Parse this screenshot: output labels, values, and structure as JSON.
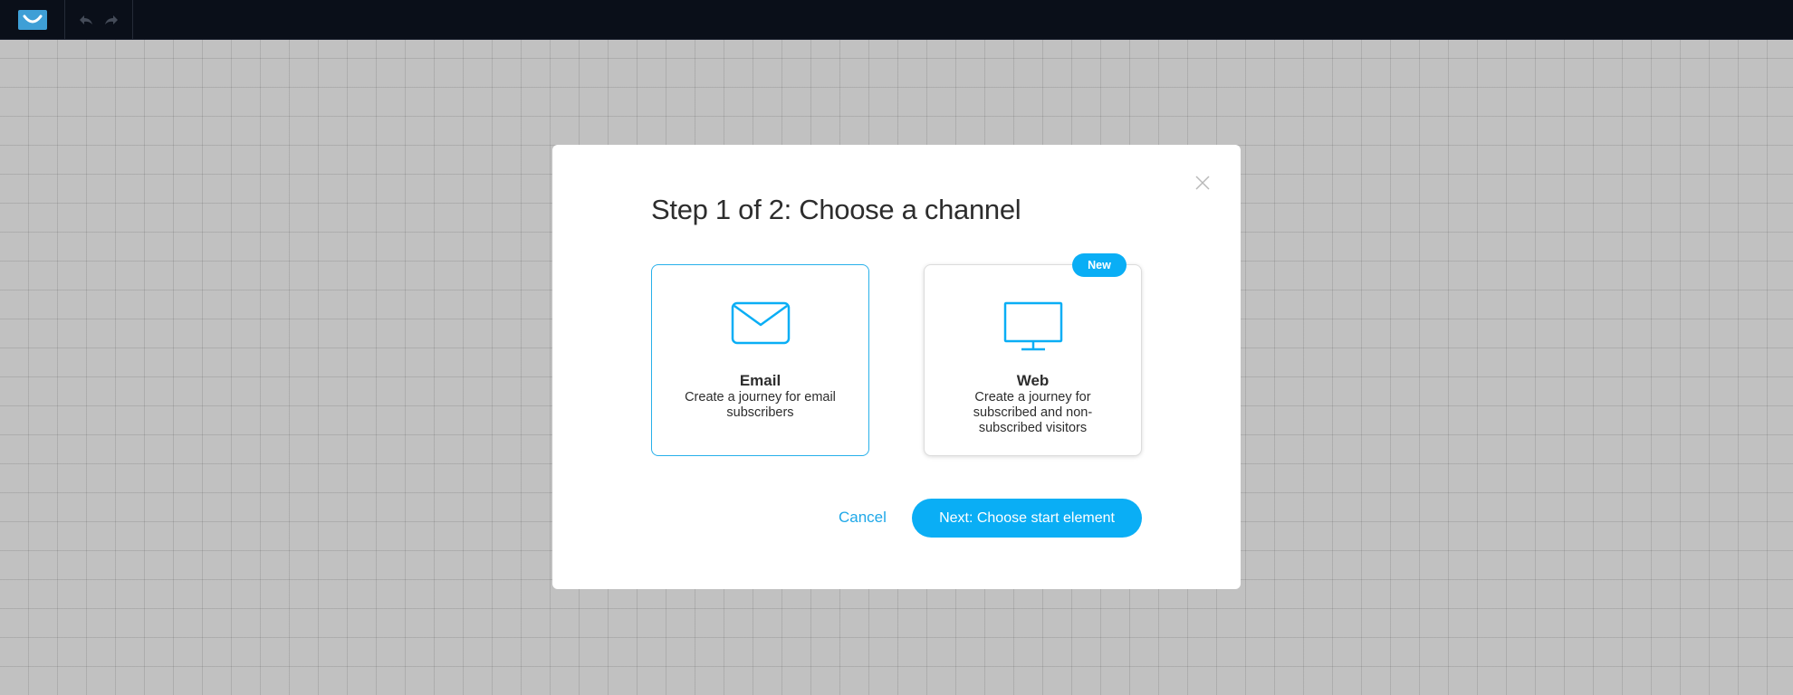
{
  "topbar": {
    "logo_icon": "logo-icon",
    "undo_icon": "undo-icon",
    "redo_icon": "redo-icon"
  },
  "modal": {
    "title": "Step 1 of 2: Choose a channel",
    "close_icon": "close-icon",
    "cards": [
      {
        "title": "Email",
        "description": "Create a journey for email subscribers",
        "icon": "envelope-icon",
        "selected": true
      },
      {
        "title": "Web",
        "description": "Create a journey for subscribed and non-subscribed visitors",
        "icon": "monitor-icon",
        "badge": "New",
        "selected": false
      }
    ],
    "cancel_label": "Cancel",
    "next_label": "Next: Choose start element"
  },
  "colors": {
    "accent": "#0aaef5",
    "topbar": "#0a0f19",
    "overlay": "#c1c1c1"
  }
}
